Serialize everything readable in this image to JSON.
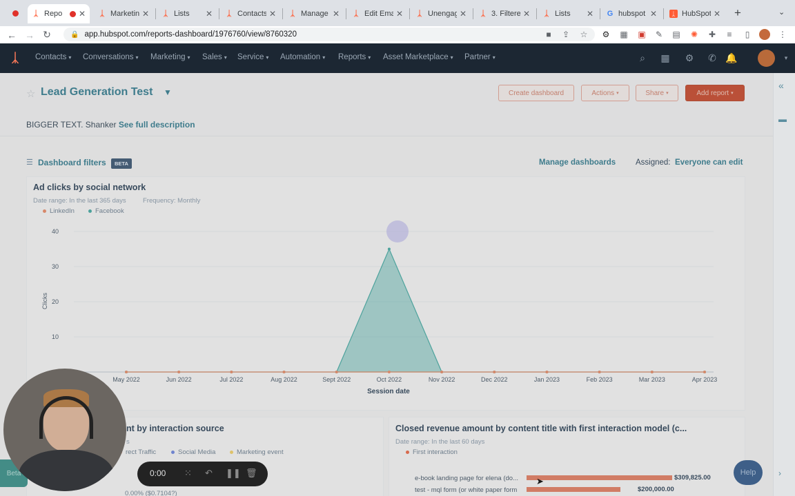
{
  "browser": {
    "tabs": [
      {
        "label": "Repo",
        "icon": "hubspot-icon",
        "recording": true
      },
      {
        "label": "Marketin",
        "icon": "hubspot-icon"
      },
      {
        "label": "Lists",
        "icon": "hubspot-icon"
      },
      {
        "label": "Contacts",
        "icon": "hubspot-icon"
      },
      {
        "label": "Manage",
        "icon": "hubspot-icon"
      },
      {
        "label": "Edit Ema",
        "icon": "hubspot-icon"
      },
      {
        "label": "Unengag",
        "icon": "hubspot-icon"
      },
      {
        "label": "3. Filtere",
        "icon": "hubspot-icon"
      },
      {
        "label": "Lists",
        "icon": "hubspot-icon"
      },
      {
        "label": "hubspot",
        "icon": "google-icon"
      },
      {
        "label": "HubSpot",
        "icon": "hubspot-square-icon"
      }
    ],
    "url": "app.hubspot.com/reports-dashboard/1976760/view/8760320"
  },
  "nav": {
    "items": [
      "Contacts",
      "Conversations",
      "Marketing",
      "Sales",
      "Service",
      "Automation",
      "Reports",
      "Asset Marketplace",
      "Partner"
    ]
  },
  "dashboard": {
    "title": "Lead Generation Test",
    "description": "BIGGER TEXT. Shanker",
    "description_link": "See full description",
    "buttons": {
      "create": "Create dashboard",
      "actions": "Actions",
      "share": "Share",
      "add_report": "Add report"
    },
    "filters_label": "Dashboard filters",
    "filters_badge": "BETA",
    "manage_dashboards": "Manage dashboards",
    "assigned_label": "Assigned:",
    "assigned_value": "Everyone can edit"
  },
  "chart1": {
    "title": "Ad clicks by social network",
    "date_range": "Date range: In the last 365 days",
    "frequency": "Frequency: Monthly",
    "legend": [
      {
        "name": "LinkedIn",
        "color": "#e08a6a"
      },
      {
        "name": "Facebook",
        "color": "#4aa7a0"
      }
    ]
  },
  "chart_data": {
    "type": "area",
    "title": "Ad clicks by social network",
    "xlabel": "Session date",
    "ylabel": "Clicks",
    "categories": [
      "May 2022",
      "Jun 2022",
      "Jul 2022",
      "Aug 2022",
      "Sept 2022",
      "Oct 2022",
      "Nov 2022",
      "Dec 2022",
      "Jan 2023",
      "Feb 2023",
      "Mar 2023",
      "Apr 2023"
    ],
    "yticks": [
      10,
      20,
      30,
      40
    ],
    "ylim": [
      0,
      40
    ],
    "series": [
      {
        "name": "Facebook",
        "color": "#4aa7a0",
        "values": [
          0,
          0,
          0,
          0,
          0,
          35,
          0,
          0,
          0,
          0,
          0,
          0
        ]
      },
      {
        "name": "LinkedIn",
        "color": "#e08a6a",
        "values": [
          0,
          0,
          0,
          0,
          0,
          0,
          0,
          0,
          0,
          0,
          0,
          0
        ]
      }
    ],
    "legend_position": "top-left"
  },
  "chart2": {
    "title": "nt by interaction source",
    "sub": "s",
    "legend": [
      {
        "name": "rect Traffic",
        "color": "#f2a380"
      },
      {
        "name": "Social Media",
        "color": "#6f86d6"
      },
      {
        "name": "Marketing event",
        "color": "#e8c96a"
      }
    ],
    "footer": "0.00% ($0.7104?)"
  },
  "chart3": {
    "title": "Closed revenue amount by content title with first interaction model (c...",
    "date_range": "Date range: In the last 60 days",
    "legend": [
      {
        "name": "First interaction",
        "color": "#e06a4a"
      }
    ],
    "rows": [
      {
        "label": "e-book landing page for elena (do...",
        "value": "$309,825.00",
        "fraction": 1.0
      },
      {
        "label": "test - mql form (or white paper form",
        "value": "$200,000.00",
        "fraction": 0.646
      }
    ]
  },
  "recorder": {
    "time": "0:00"
  },
  "beta_tab": "Beta",
  "help": "Help"
}
